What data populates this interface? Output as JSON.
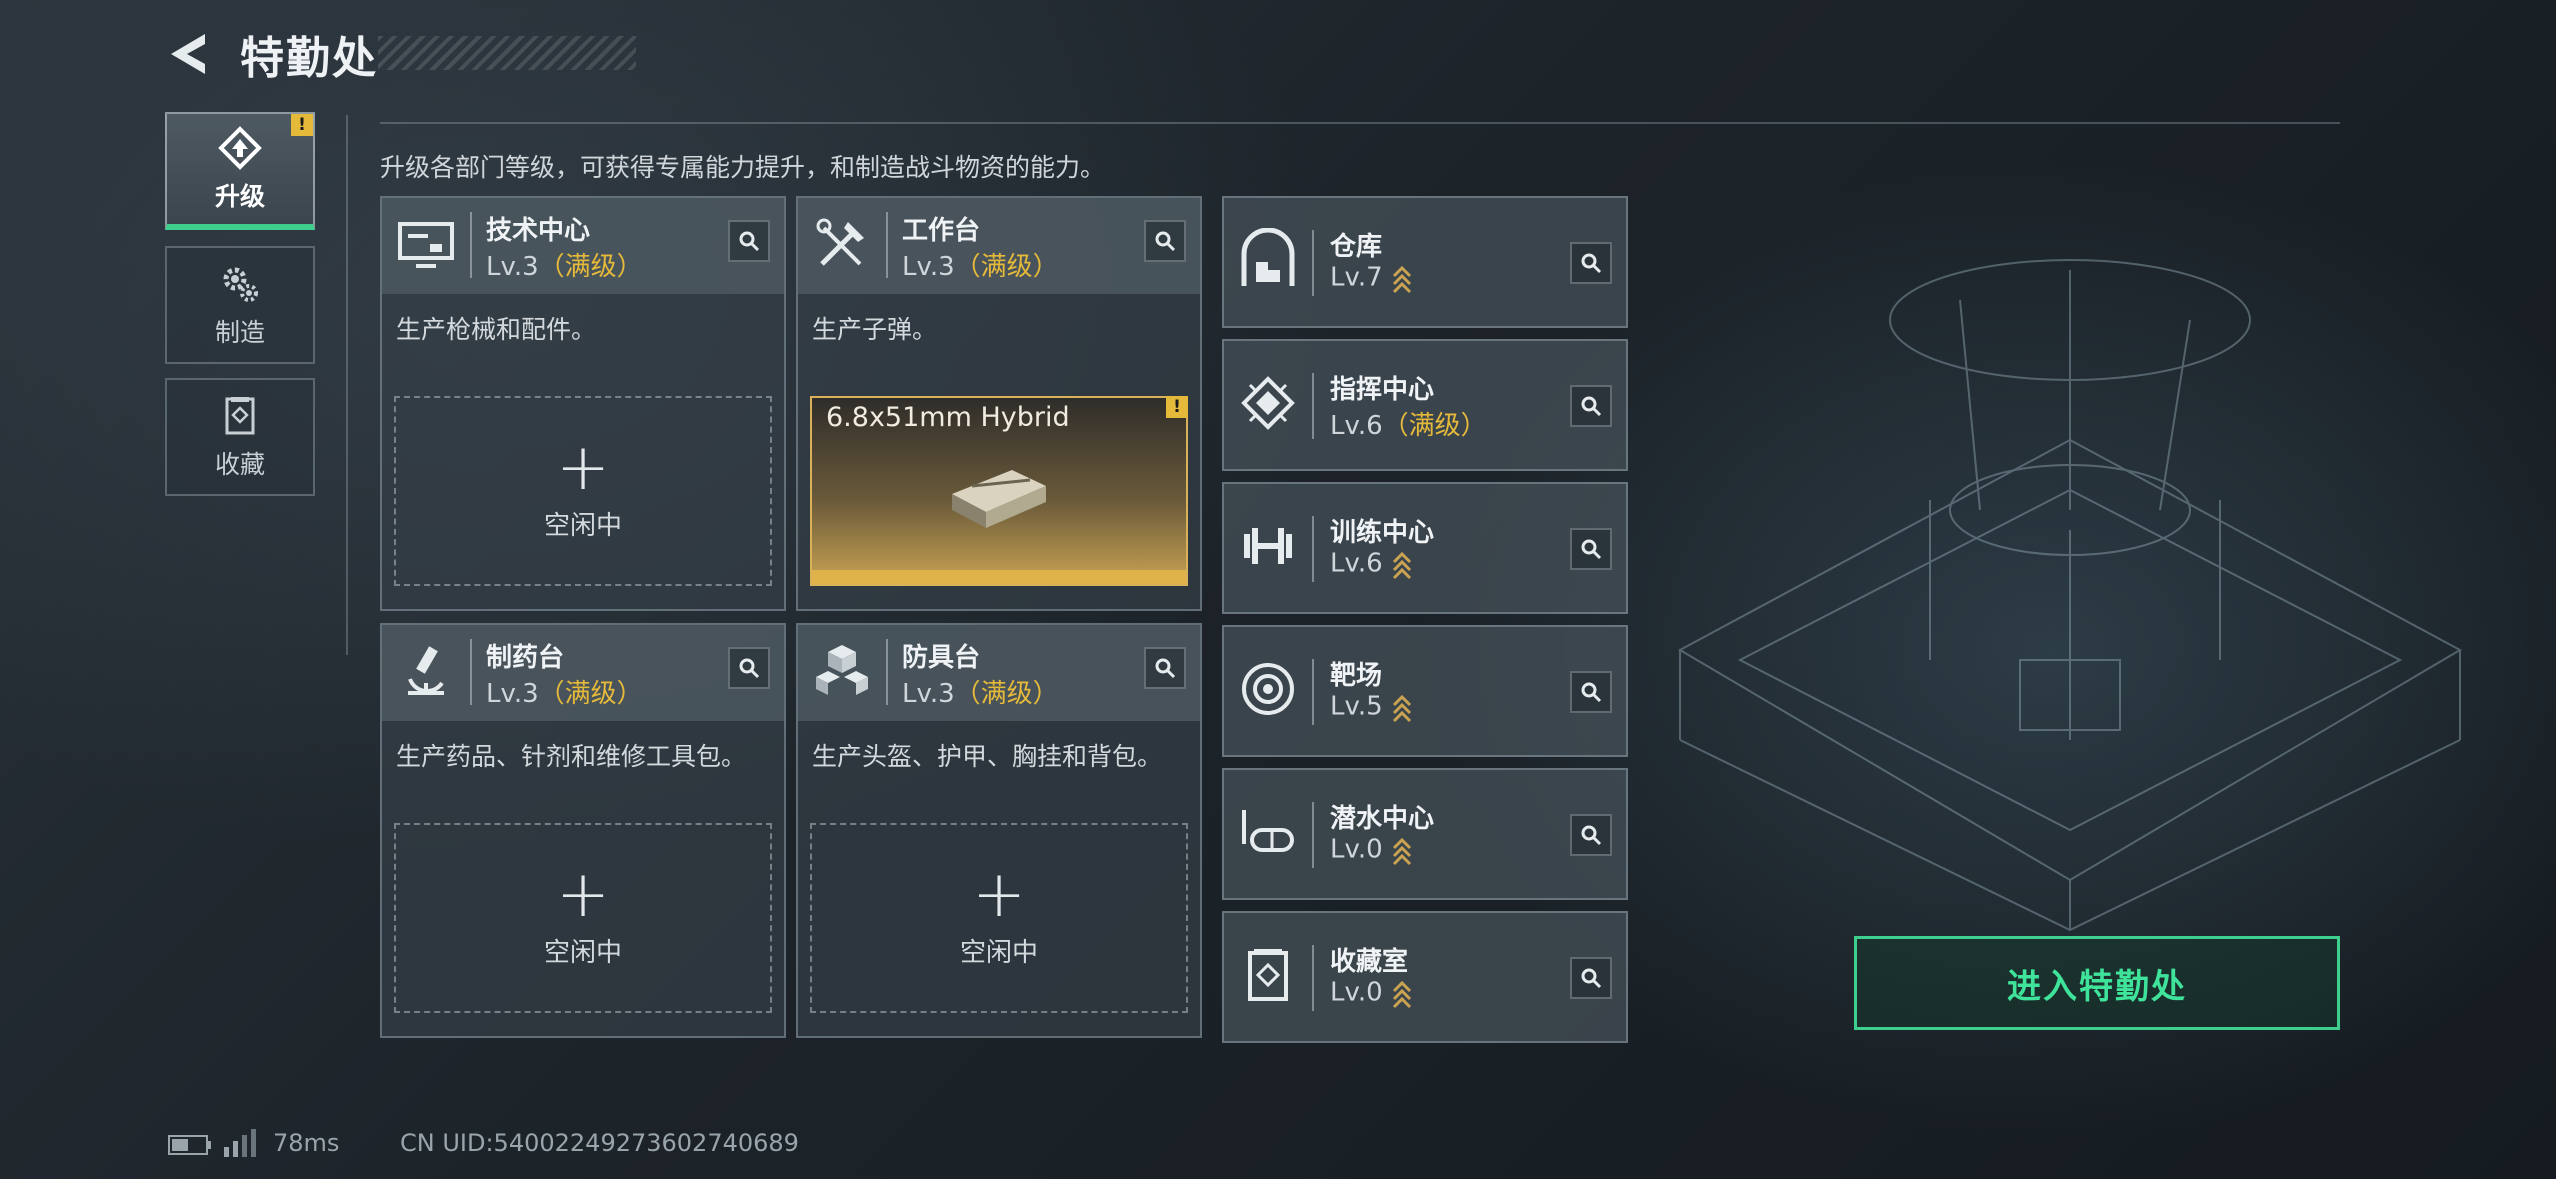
{
  "header": {
    "title": "特勤处"
  },
  "tabs": [
    {
      "label": "升级",
      "icon": "upgrade-icon",
      "active": true,
      "alert": "!"
    },
    {
      "label": "制造",
      "icon": "gears-icon",
      "active": false
    },
    {
      "label": "收藏",
      "icon": "collection-icon",
      "active": false
    }
  ],
  "description": "升级各部门等级，可获得专属能力提升，和制造战斗物资的能力。",
  "stations": [
    {
      "name": "技术中心",
      "level": "Lv.3",
      "max_tag": "（满级）",
      "desc": "生产枪械和配件。",
      "slot": {
        "state": "idle",
        "plus": "+",
        "text": "空闲中"
      },
      "icon": "monitor-icon"
    },
    {
      "name": "工作台",
      "level": "Lv.3",
      "max_tag": "（满级）",
      "desc": "生产子弹。",
      "slot": {
        "state": "producing",
        "item": "6.8x51mm Hybrid",
        "alert": "!"
      },
      "icon": "tools-icon"
    },
    {
      "name": "制药台",
      "level": "Lv.3",
      "max_tag": "（满级）",
      "desc": "生产药品、针剂和维修工具包。",
      "slot": {
        "state": "idle",
        "plus": "+",
        "text": "空闲中"
      },
      "icon": "microscope-icon"
    },
    {
      "name": "防具台",
      "level": "Lv.3",
      "max_tag": "（满级）",
      "desc": "生产头盔、护甲、胸挂和背包。",
      "slot": {
        "state": "idle",
        "plus": "+",
        "text": "空闲中"
      },
      "icon": "armor-cubes-icon"
    }
  ],
  "buildings": [
    {
      "name": "仓库",
      "level": "Lv.7",
      "max_tag": "",
      "upgradeable": true,
      "icon": "warehouse-icon"
    },
    {
      "name": "指挥中心",
      "level": "Lv.6",
      "max_tag": "（满级）",
      "upgradeable": false,
      "icon": "command-chip-icon"
    },
    {
      "name": "训练中心",
      "level": "Lv.6",
      "max_tag": "",
      "upgradeable": true,
      "icon": "dumbbell-icon"
    },
    {
      "name": "靶场",
      "level": "Lv.5",
      "max_tag": "",
      "upgradeable": true,
      "icon": "target-icon"
    },
    {
      "name": "潜水中心",
      "level": "Lv.0",
      "max_tag": "",
      "upgradeable": true,
      "icon": "diving-mask-icon"
    },
    {
      "name": "收藏室",
      "level": "Lv.0",
      "max_tag": "",
      "upgradeable": true,
      "icon": "collection-room-icon"
    }
  ],
  "enter_button": {
    "label": "进入特勤处"
  },
  "status_bar": {
    "ping": "78ms",
    "uid": "CN UID:54002249273602740689"
  },
  "colors": {
    "accent_green": "#3ecf8e",
    "max_gold": "#e5b93a",
    "alert_yellow": "#e5b93a"
  }
}
